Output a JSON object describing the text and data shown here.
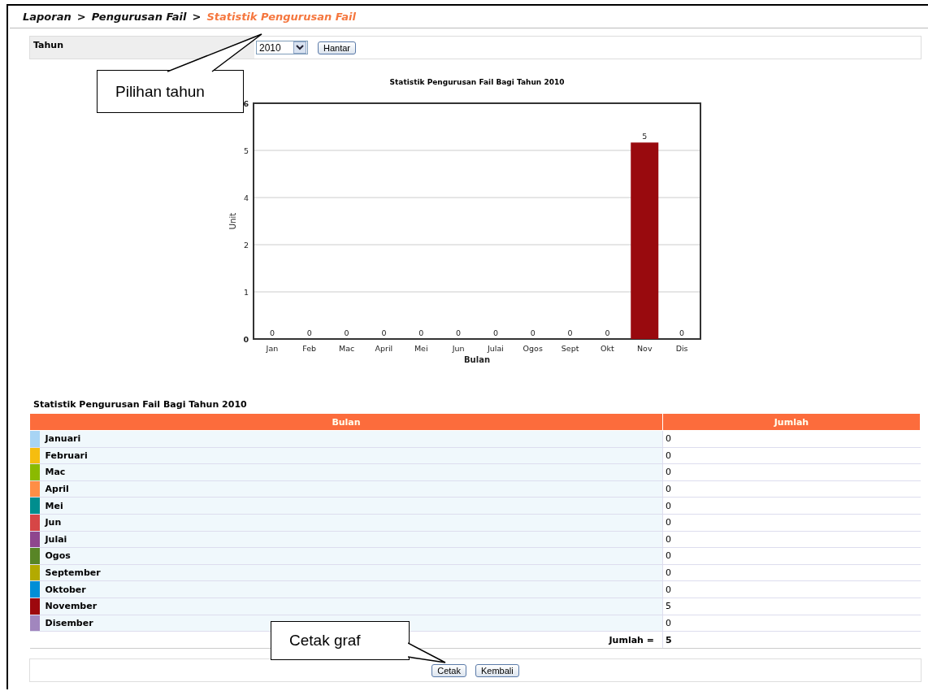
{
  "breadcrumb": [
    {
      "label": "Laporan",
      "current": false
    },
    {
      "label": "Pengurusan Fail",
      "current": false
    },
    {
      "label": "Statistik Pengurusan Fail",
      "current": true
    }
  ],
  "breadcrumb_separator": ">",
  "form": {
    "label": "Tahun",
    "year": "2010",
    "submit": "Hantar"
  },
  "callouts": [
    {
      "text": "Pilihan tahun",
      "kind": "up"
    },
    {
      "text": "Cetak graf",
      "kind": "down"
    }
  ],
  "chart": {
    "chart_data": {
      "type": "bar",
      "title": "Statistik Pengurusan Fail Bagi Tahun 2010",
      "xlabel": "Bulan",
      "ylabel": "Unit",
      "categories": [
        "Jan",
        "Feb",
        "Mac",
        "April",
        "Mei",
        "Jun",
        "Julai",
        "Ogos",
        "Sept",
        "Okt",
        "Nov",
        "Dis"
      ],
      "series": [
        {
          "color": "#990a0e",
          "values": [
            0,
            0,
            0,
            0,
            0,
            0,
            0,
            0,
            0,
            0,
            5,
            0
          ]
        }
      ],
      "grid": true,
      "ylim": [
        0,
        6
      ],
      "yticks": [
        {
          "value": 0,
          "label": "0"
        },
        {
          "value": 1.2,
          "label": "1"
        },
        {
          "value": 2.4,
          "label": "2"
        },
        {
          "value": 3.6,
          "label": "4"
        },
        {
          "value": 4.8,
          "label": "5"
        },
        {
          "value": 6,
          "label": "6"
        }
      ],
      "data_labels": true
    }
  },
  "table": {
    "title": "Statistik Pengurusan Fail Bagi Tahun 2010",
    "columns": [
      "Bulan",
      "Jumlah"
    ],
    "rows": [
      {
        "month": "Januari",
        "count": "0",
        "color": "#a8d4f4"
      },
      {
        "month": "Februari",
        "count": "0",
        "color": "#f6bd0f"
      },
      {
        "month": "Mac",
        "count": "0",
        "color": "#8bba00"
      },
      {
        "month": "April",
        "count": "0",
        "color": "#ff8e46"
      },
      {
        "month": "Mei",
        "count": "0",
        "color": "#008e8e"
      },
      {
        "month": "Jun",
        "count": "0",
        "color": "#d64646"
      },
      {
        "month": "Julai",
        "count": "0",
        "color": "#8e468e"
      },
      {
        "month": "Ogos",
        "count": "0",
        "color": "#588526"
      },
      {
        "month": "September",
        "count": "0",
        "color": "#b3aa00"
      },
      {
        "month": "Oktober",
        "count": "0",
        "color": "#008ed6"
      },
      {
        "month": "November",
        "count": "5",
        "color": "#9d080d"
      },
      {
        "month": "Disember",
        "count": "0",
        "color": "#a186be"
      }
    ],
    "total_label": "Jumlah =",
    "total": "5"
  },
  "buttons": [
    "Cetak",
    "Kembali"
  ]
}
